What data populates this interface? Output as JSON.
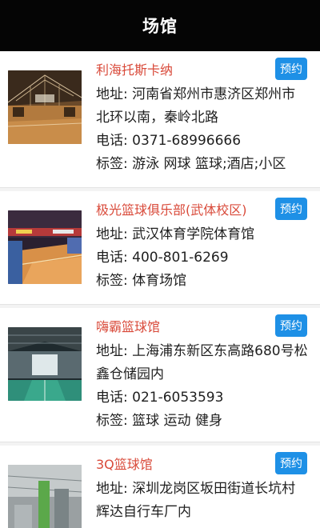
{
  "header": {
    "title": "场馆"
  },
  "venues": [
    {
      "name": "利海托斯卡纳",
      "button": "预约",
      "address": "地址: 河南省郑州市惠济区郑州市北环以南，秦岭北路",
      "phone": "电话: 0371-68996666",
      "tags": "标签: 游泳 网球 篮球;酒店;小区"
    },
    {
      "name": "极光篮球俱乐部(武体校区)",
      "button": "预约",
      "address": "地址: 武汉体育学院体育馆",
      "phone": "电话: 400-801-6269",
      "tags": "标签: 体育场馆"
    },
    {
      "name": "嗨霸篮球馆",
      "button": "预约",
      "address": "地址: 上海浦东新区东高路680号松鑫仓储园内",
      "phone": "电话: 021-6053593",
      "tags": "标签: 篮球 运动 健身"
    },
    {
      "name": "3Q篮球馆",
      "button": "预约",
      "address": "地址: 深圳龙岗区坂田街道长坑村辉达自行车厂内"
    }
  ]
}
